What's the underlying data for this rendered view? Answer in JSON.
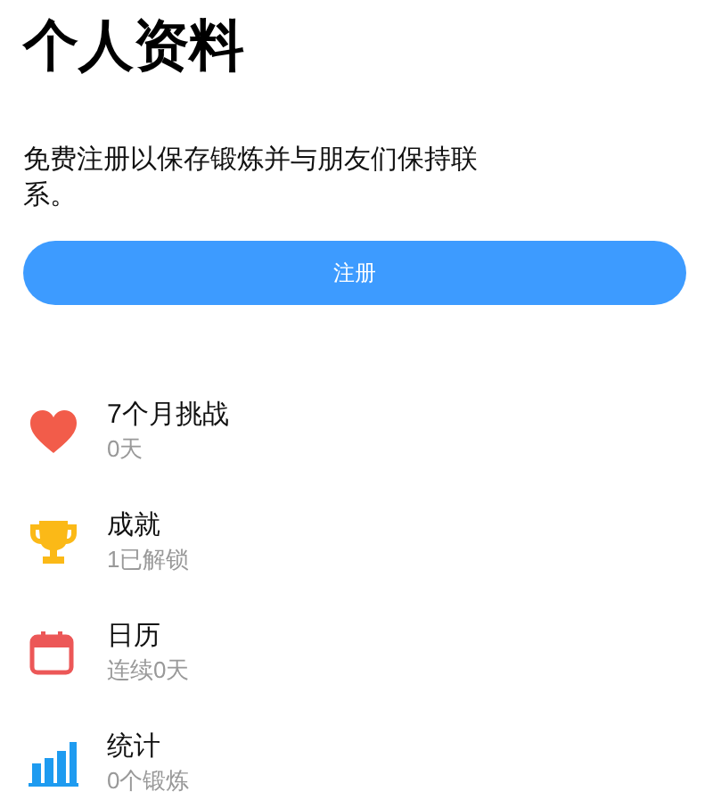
{
  "title": "个人资料",
  "prompt": "免费注册以保存锻炼并与朋友们保持联系。",
  "register_button": "注册",
  "items": [
    {
      "kind": "heart",
      "title": "7个月挑战",
      "subtitle": "0天"
    },
    {
      "kind": "trophy",
      "title": "成就",
      "subtitle": "1已解锁"
    },
    {
      "kind": "calendar",
      "title": "日历",
      "subtitle": "连续0天"
    },
    {
      "kind": "chart",
      "title": "统计",
      "subtitle": "0个锻炼"
    }
  ]
}
